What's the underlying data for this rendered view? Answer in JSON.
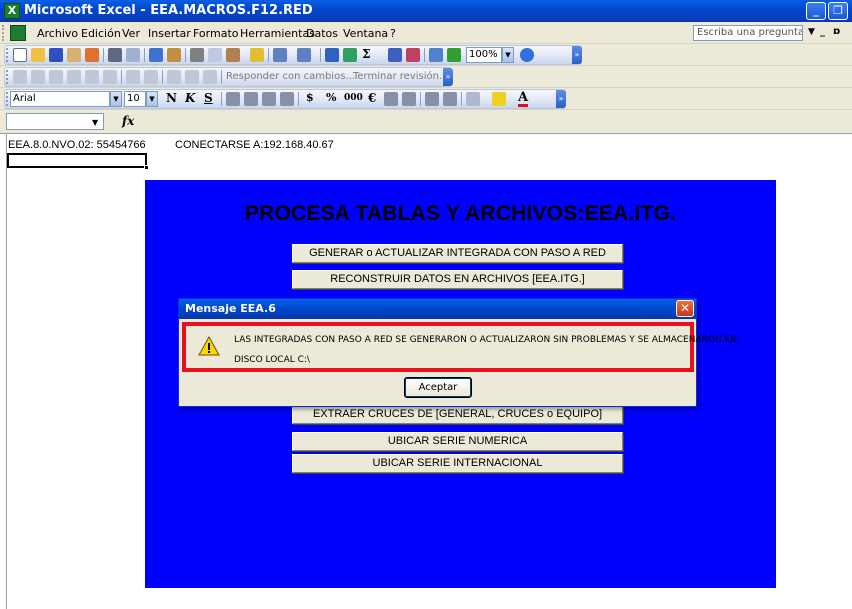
{
  "window": {
    "title": "Microsoft Excel - EEA.MACROS.F12.RED",
    "app_icon": "excel-icon",
    "controls": {
      "minimize": "_",
      "maximize": "❐",
      "close": "X"
    }
  },
  "menu": {
    "items": [
      "Archivo",
      "Edición",
      "Ver",
      "Insertar",
      "Formato",
      "Herramientas",
      "Datos",
      "Ventana",
      "?"
    ],
    "help_placeholder": "Escriba una pregunta"
  },
  "toolbar_standard": {
    "zoom": "100%"
  },
  "toolbar_review": {
    "respond": "Responder con cambios...",
    "end_review": "Terminar revisión..."
  },
  "toolbar_format": {
    "font": "Arial",
    "size": "10",
    "bold": "N",
    "italic": "K",
    "underline": "S",
    "currency": "$",
    "percent": "%",
    "thousands": "000",
    "euro": "€",
    "font_color_label": "A"
  },
  "formula_bar": {
    "fx_label": "fx"
  },
  "sheet": {
    "cell_a1": "EEA.8.0.NVO.02: 55454766",
    "cell_conn": "CONECTARSE A:192.168.40.67"
  },
  "panel": {
    "bg_color": "#0000ff",
    "title": "PROCESA TABLAS Y ARCHIVOS:EEA.ITG.",
    "buttons": [
      "GENERAR o ACTUALIZAR INTEGRADA CON PASO A RED",
      "RECONSTRUIR DATOS EN ARCHIVOS [EEA.ITG.]",
      "EXTRAER CRUCES DE [GENERAL, CRUCES o EQUIPO]",
      "UBICAR SERIE NUMERICA",
      "UBICAR SERIE INTERNACIONAL"
    ]
  },
  "dialog": {
    "title": "Mensaje EEA.6",
    "icon": "warning-icon",
    "message_line1": "LAS INTEGRADAS CON PASO A RED SE GENERARON O ACTUALIZARON SIN PROBLEMAS Y SE ALMACENARON EN:",
    "message_line2": "DISCO LOCAL C:\\",
    "ok_label": "Aceptar",
    "highlight_color": "#e8101c"
  }
}
